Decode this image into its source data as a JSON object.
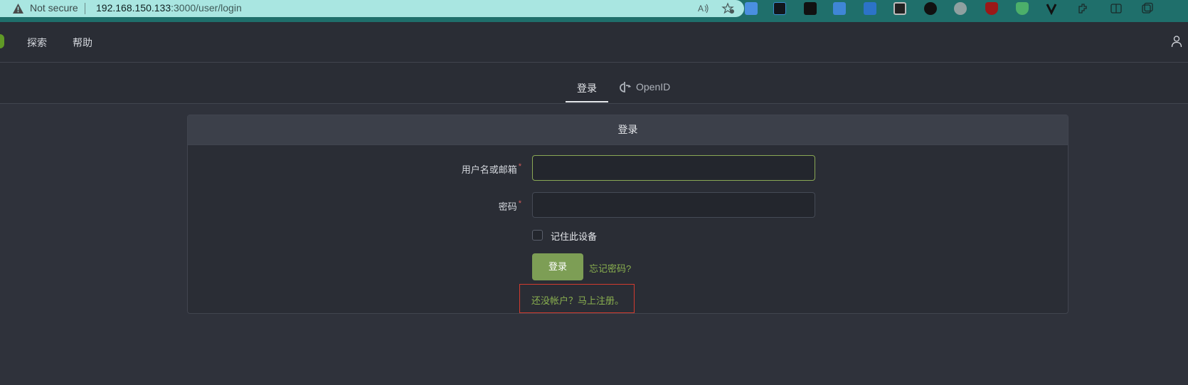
{
  "browser": {
    "security_label": "Not secure",
    "url_host": "192.168.150.133",
    "url_rest": ":3000/user/login",
    "icons": [
      "warning-icon",
      "read-aloud-icon",
      "favorite-icon",
      "image-ext-icon",
      "ext-icon-2",
      "ext-icon-3",
      "ext-icon-4",
      "ext-icon-5",
      "ext-icon-6",
      "ext-icon-7",
      "ext-icon-8",
      "ublock-icon",
      "shield-ext-icon",
      "v-ext-icon",
      "extensions-icon",
      "split-screen-icon",
      "collections-icon"
    ]
  },
  "nav": {
    "explore": "探索",
    "help": "帮助"
  },
  "tabs": {
    "login": "登录",
    "openid": "OpenID"
  },
  "form": {
    "header": "登录",
    "username_label": "用户名或邮箱",
    "username_value": "",
    "password_label": "密码",
    "password_value": "",
    "required_mark": "*",
    "remember_label": "记住此设备",
    "submit_label": "登录",
    "forgot_label": "忘记密码?",
    "register_label": "还没帐户？马上注册。"
  },
  "colors": {
    "accent": "#7d9e55",
    "link": "#8ab04f",
    "highlight_box": "#d23b2f"
  }
}
